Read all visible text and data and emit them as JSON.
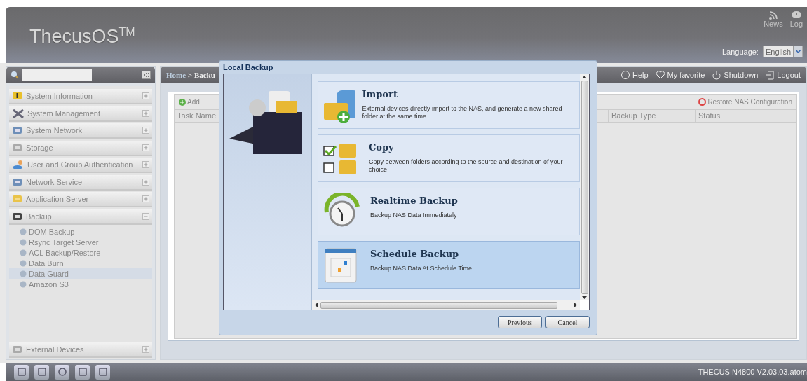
{
  "header": {
    "logo": "ThecusOS$^{TM}$",
    "links": [
      {
        "label": "News"
      },
      {
        "label": "Log"
      }
    ],
    "language": {
      "label": "Language:",
      "value": "English"
    }
  },
  "sidebar": {
    "sections": [
      {
        "label": "System Information",
        "expanded": false
      },
      {
        "label": "System Management",
        "expanded": false
      },
      {
        "label": "System Network",
        "expanded": false
      },
      {
        "label": "Storage",
        "expanded": false
      },
      {
        "label": "User and Group Authentication",
        "expanded": false
      },
      {
        "label": "Network Service",
        "expanded": false
      },
      {
        "label": "Application Server",
        "expanded": false
      },
      {
        "label": "Backup",
        "expanded": true,
        "children": [
          {
            "label": "DOM Backup",
            "selected": false
          },
          {
            "label": "Rsync Target Server",
            "selected": false
          },
          {
            "label": "ACL Backup/Restore",
            "selected": false
          },
          {
            "label": "Data Burn",
            "selected": false
          },
          {
            "label": "Data Guard",
            "selected": true
          },
          {
            "label": "Amazon S3",
            "selected": false
          }
        ]
      }
    ],
    "bottom_section": {
      "label": "External Devices",
      "expanded": false
    }
  },
  "breadcrumb": {
    "home": "Home",
    "separator": ">",
    "current": "Backu"
  },
  "top_actions": [
    {
      "label": "Help"
    },
    {
      "label": "My favorite"
    },
    {
      "label": "Shutdown"
    },
    {
      "label": "Logout"
    }
  ],
  "panel": {
    "toolbar": {
      "add": "Add",
      "restore": "Restore NAS Configuration"
    },
    "columns": [
      "Task Name",
      "Backup Type",
      "Status"
    ]
  },
  "dialog": {
    "title": "Local Backup",
    "options": [
      {
        "title": "Import",
        "description": "External devices directly import to the NAS, and generate a new shared folder at the same time",
        "selected": false
      },
      {
        "title": "Copy",
        "description": "Copy between folders according to the source and destination of your choice",
        "selected": false
      },
      {
        "title": "Realtime Backup",
        "description": "Backup NAS Data Immediately",
        "selected": false
      },
      {
        "title": "Schedule Backup",
        "description": "Backup NAS Data At Schedule Time",
        "selected": true
      }
    ],
    "buttons": [
      {
        "label": "Previous"
      },
      {
        "label": "Cancel"
      }
    ]
  },
  "status_bar": {
    "text": "THECUS N4800 V2.03.03.atom"
  }
}
